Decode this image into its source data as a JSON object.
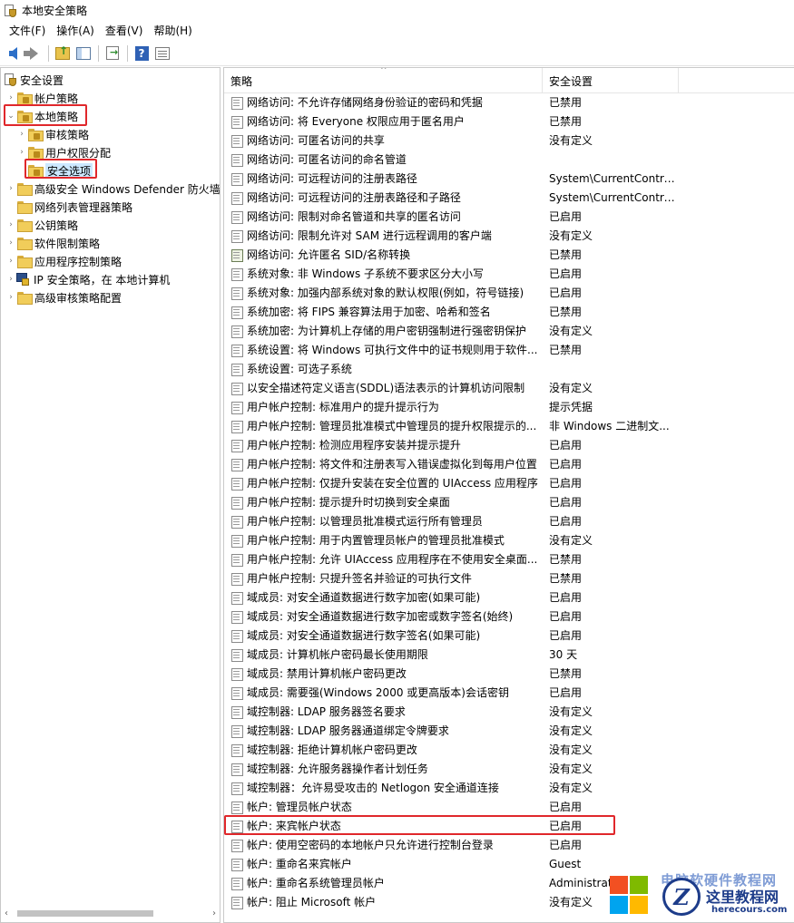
{
  "window": {
    "title": "本地安全策略"
  },
  "menu": [
    {
      "label": "文件(F)"
    },
    {
      "label": "操作(A)"
    },
    {
      "label": "查看(V)"
    },
    {
      "label": "帮助(H)"
    }
  ],
  "toolbar": {
    "icons": [
      "back-icon",
      "forward-icon",
      "up-folder-icon",
      "show-tree-icon",
      "export-list-icon",
      "help-icon",
      "properties-icon"
    ],
    "help_glyph": "?"
  },
  "tree": {
    "root": "安全设置",
    "items": [
      {
        "label": "帐户策略",
        "level": 1,
        "expander": "›"
      },
      {
        "label": "本地策略",
        "level": 1,
        "expander": "⌄"
      },
      {
        "label": "审核策略",
        "level": 2,
        "expander": "›"
      },
      {
        "label": "用户权限分配",
        "level": 2,
        "expander": "›"
      },
      {
        "label": "安全选项",
        "level": 2,
        "expander": ""
      },
      {
        "label": "高级安全 Windows Defender 防火墙",
        "level": 1,
        "expander": "›"
      },
      {
        "label": "网络列表管理器策略",
        "level": 1,
        "expander": ""
      },
      {
        "label": "公钥策略",
        "level": 1,
        "expander": "›"
      },
      {
        "label": "软件限制策略",
        "level": 1,
        "expander": "›"
      },
      {
        "label": "应用程序控制策略",
        "level": 1,
        "expander": "›"
      },
      {
        "label": "IP 安全策略，在 本地计算机",
        "level": 1,
        "expander": "›"
      },
      {
        "label": "高级审核策略配置",
        "level": 1,
        "expander": "›"
      }
    ],
    "scroll_left": "‹",
    "scroll_right": "›"
  },
  "list": {
    "columns": [
      "策略",
      "安全设置"
    ],
    "rows": [
      {
        "name": "网络访问: 不允许存储网络身份验证的密码和凭据",
        "value": "已禁用"
      },
      {
        "name": "网络访问: 将 Everyone 权限应用于匿名用户",
        "value": "已禁用"
      },
      {
        "name": "网络访问: 可匿名访问的共享",
        "value": "没有定义"
      },
      {
        "name": "网络访问: 可匿名访问的命名管道",
        "value": ""
      },
      {
        "name": "网络访问: 可远程访问的注册表路径",
        "value": "System\\CurrentContro..."
      },
      {
        "name": "网络访问: 可远程访问的注册表路径和子路径",
        "value": "System\\CurrentContro..."
      },
      {
        "name": "网络访问: 限制对命名管道和共享的匿名访问",
        "value": "已启用"
      },
      {
        "name": "网络访问: 限制允许对 SAM 进行远程调用的客户端",
        "value": "没有定义"
      },
      {
        "name": "网络访问: 允许匿名 SID/名称转换",
        "value": "已禁用"
      },
      {
        "name": "系统对象: 非 Windows 子系统不要求区分大小写",
        "value": "已启用"
      },
      {
        "name": "系统对象: 加强内部系统对象的默认权限(例如，符号链接)",
        "value": "已启用"
      },
      {
        "name": "系统加密: 将 FIPS 兼容算法用于加密、哈希和签名",
        "value": "已禁用"
      },
      {
        "name": "系统加密: 为计算机上存储的用户密钥强制进行强密钥保护",
        "value": "没有定义"
      },
      {
        "name": "系统设置: 将 Windows 可执行文件中的证书规则用于软件...",
        "value": "已禁用"
      },
      {
        "name": "系统设置: 可选子系统",
        "value": ""
      },
      {
        "name": "以安全描述符定义语言(SDDL)语法表示的计算机访问限制",
        "value": "没有定义"
      },
      {
        "name": "用户帐户控制: 标准用户的提升提示行为",
        "value": "提示凭据"
      },
      {
        "name": "用户帐户控制: 管理员批准模式中管理员的提升权限提示的...",
        "value": "非 Windows 二进制文..."
      },
      {
        "name": "用户帐户控制: 检测应用程序安装并提示提升",
        "value": "已启用"
      },
      {
        "name": "用户帐户控制: 将文件和注册表写入错误虚拟化到每用户位置",
        "value": "已启用"
      },
      {
        "name": "用户帐户控制: 仅提升安装在安全位置的 UIAccess 应用程序",
        "value": "已启用"
      },
      {
        "name": "用户帐户控制: 提示提升时切换到安全桌面",
        "value": "已启用"
      },
      {
        "name": "用户帐户控制: 以管理员批准模式运行所有管理员",
        "value": "已启用"
      },
      {
        "name": "用户帐户控制: 用于内置管理员帐户的管理员批准模式",
        "value": "没有定义"
      },
      {
        "name": "用户帐户控制: 允许 UIAccess 应用程序在不使用安全桌面...",
        "value": "已禁用"
      },
      {
        "name": "用户帐户控制: 只提升签名并验证的可执行文件",
        "value": "已禁用"
      },
      {
        "name": "域成员: 对安全通道数据进行数字加密(如果可能)",
        "value": "已启用"
      },
      {
        "name": "域成员: 对安全通道数据进行数字加密或数字签名(始终)",
        "value": "已启用"
      },
      {
        "name": "域成员: 对安全通道数据进行数字签名(如果可能)",
        "value": "已启用"
      },
      {
        "name": "域成员: 计算机帐户密码最长使用期限",
        "value": "30 天"
      },
      {
        "name": "域成员: 禁用计算机帐户密码更改",
        "value": "已禁用"
      },
      {
        "name": "域成员: 需要强(Windows 2000 或更高版本)会话密钥",
        "value": "已启用"
      },
      {
        "name": "域控制器: LDAP 服务器签名要求",
        "value": "没有定义"
      },
      {
        "name": "域控制器: LDAP 服务器通道绑定令牌要求",
        "value": "没有定义"
      },
      {
        "name": "域控制器: 拒绝计算机帐户密码更改",
        "value": "没有定义"
      },
      {
        "name": "域控制器: 允许服务器操作者计划任务",
        "value": "没有定义"
      },
      {
        "name": "域控制器：允许易受攻击的 Netlogon 安全通道连接",
        "value": "没有定义"
      },
      {
        "name": "帐户: 管理员帐户状态",
        "value": "已启用"
      },
      {
        "name": "帐户: 来宾帐户状态",
        "value": "已启用"
      },
      {
        "name": "帐户: 使用空密码的本地帐户只允许进行控制台登录",
        "value": "已启用"
      },
      {
        "name": "帐户: 重命名来宾帐户",
        "value": "Guest"
      },
      {
        "name": "帐户: 重命名系统管理员帐户",
        "value": "Administrat"
      },
      {
        "name": "帐户: 阻止 Microsoft 帐户",
        "value": "没有定义"
      }
    ]
  },
  "watermark": {
    "top": "电脑软硬件教程网",
    "cn": "这里教程网",
    "url": "herecours.com",
    "badge": "Z"
  },
  "colors": {
    "highlight_box": "#e0272b",
    "selection": "#cce8ff",
    "folder": "#f1cd5a"
  }
}
